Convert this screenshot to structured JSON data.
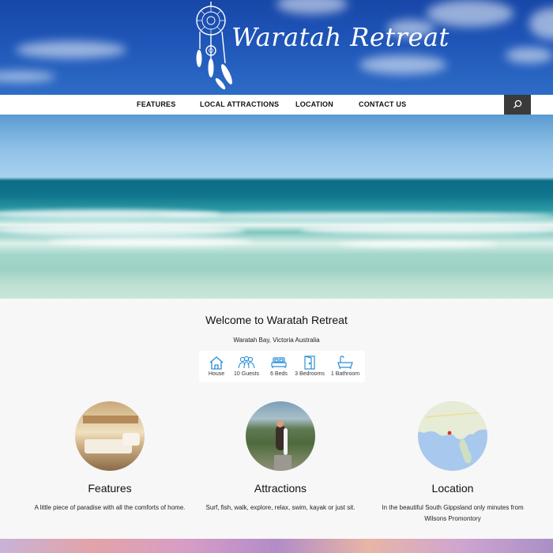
{
  "site": {
    "title": "Waratah Retreat"
  },
  "nav": {
    "items": [
      {
        "label": "FEATURES"
      },
      {
        "label": "LOCAL ATTRACTIONS"
      },
      {
        "label": "LOCATION"
      },
      {
        "label": "CONTACT US"
      }
    ],
    "search_icon": "search-icon"
  },
  "welcome": {
    "title": "Welcome to Waratah Retreat",
    "subtitle": "Waratah Bay, Victoria Australia"
  },
  "amenities": [
    {
      "icon": "house-icon",
      "label": "House"
    },
    {
      "icon": "guests-icon",
      "label": "10 Guests"
    },
    {
      "icon": "bed-icon",
      "label": "6 Beds"
    },
    {
      "icon": "door-icon",
      "label": "3 Bedrooms"
    },
    {
      "icon": "bathtub-icon",
      "label": "1 Bathroom"
    }
  ],
  "columns": [
    {
      "title": "Features",
      "desc": "A little piece of paradise with all the comforts of home."
    },
    {
      "title": "Attractions",
      "desc": "Surf, fish, walk, explore, relax, swim, kayak or just sit."
    },
    {
      "title": "Location",
      "desc": "In the beautiful South Gippsland only minutes from Wilsons Promontory"
    }
  ],
  "colors": {
    "accent": "#2a8fd6",
    "header_sky": "#1f56b8",
    "nav_search": "#3a3a3a"
  }
}
